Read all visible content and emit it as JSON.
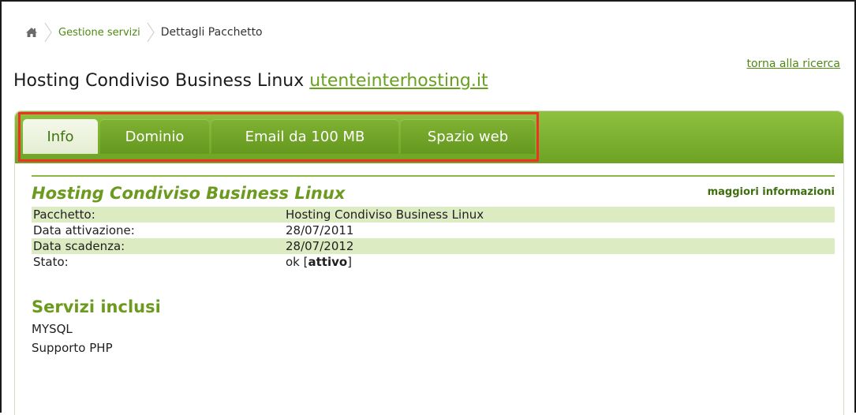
{
  "breadcrumb": {
    "home_icon": "home-icon",
    "items": [
      "Gestione servizi",
      "Dettagli Pacchetto"
    ]
  },
  "back_link": "torna alla ricerca",
  "page": {
    "title": "Hosting Condiviso Business Linux",
    "domain": "utenteinterhosting.it"
  },
  "tabs": [
    {
      "label": "Info",
      "active": true
    },
    {
      "label": "Dominio",
      "active": false
    },
    {
      "label": "Email da 100 MB",
      "active": false
    },
    {
      "label": "Spazio web",
      "active": false
    }
  ],
  "section": {
    "title": "Hosting Condiviso Business Linux",
    "more_info": "maggiori informazioni"
  },
  "details": [
    {
      "key": "Pacchetto:",
      "value": "Hosting Condiviso Business Linux"
    },
    {
      "key": "Data attivazione:",
      "value": "28/07/2011"
    },
    {
      "key": "Data scadenza:",
      "value": "28/07/2012"
    },
    {
      "key": "Stato:",
      "value_prefix": "ok [",
      "value_strong": "attivo",
      "value_suffix": "]"
    }
  ],
  "included": {
    "title": "Servizi inclusi",
    "items": [
      "MYSQL",
      "Supporto PHP"
    ]
  },
  "colors": {
    "accent_green": "#6b9a1e",
    "link_green": "#4e8a12",
    "tab_bar": "#7fb133",
    "row_highlight": "#dcebc2",
    "annotation_red": "#ef3223"
  }
}
